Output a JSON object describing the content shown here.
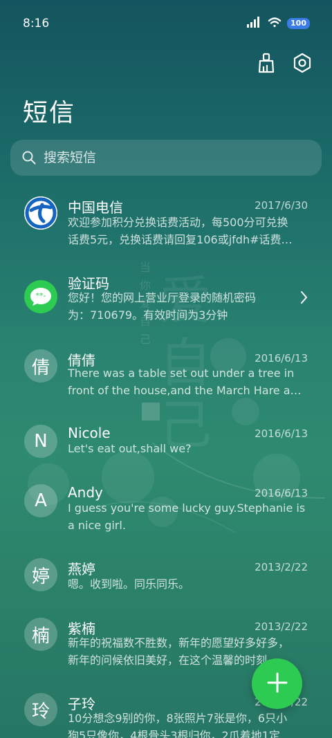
{
  "status_bar": {
    "time": "8:16",
    "battery": "100"
  },
  "header": {
    "title": "短信"
  },
  "search": {
    "placeholder": "搜索短信"
  },
  "conversations": [
    {
      "name": "中国电信",
      "date": "2017/6/30",
      "avatar_icon": "china-telecom-logo",
      "lines": [
        "欢迎参加积分兑换话费活动，每500分可兑换",
        "话费5元，兑换话费请回复106或jfdh#话费…"
      ]
    },
    {
      "name": "验证码",
      "date": "",
      "avatar_icon": "message-bubble-icon",
      "lines": [
        "您好！您的网上营业厅登录的随机密码",
        "为：710679。有效时间为3分钟"
      ]
    },
    {
      "name": "倩倩",
      "date": "2016/6/13",
      "avatar": "倩",
      "lines": [
        "There was a table set out under a tree in",
        "front of the house,and the March Hare an…"
      ]
    },
    {
      "name": "Nicole",
      "date": "2016/6/13",
      "avatar": "N",
      "lines": [
        "Let's eat out,shall we?"
      ]
    },
    {
      "name": "Andy",
      "date": "2016/6/13",
      "avatar": "A",
      "lines": [
        "I guess you're some lucky guy.Stephanie is",
        "a nice girl."
      ]
    },
    {
      "name": "燕婷",
      "date": "2013/2/22",
      "avatar": "婷",
      "lines": [
        "嗯。收到啦。同乐同乐。"
      ]
    },
    {
      "name": "紫楠",
      "date": "2013/2/22",
      "avatar": "楠",
      "lines": [
        "新年的祝福数不胜数，新年的愿望好多好多，",
        "新年的问候依旧美好，在这个温馨的时刻…"
      ]
    },
    {
      "name": "子玲",
      "date": "2013/2/22",
      "avatar": "玲",
      "lines": [
        "10分想念9别的你，8张照片7张是你，6只小",
        "狗5只像你，4根骨头3根归你，2爪着地1定…"
      ]
    }
  ],
  "wallpaper": {
    "text_column": [
      "当",
      "你",
      "爱",
      "自",
      "己"
    ],
    "big_text": "爱自己"
  },
  "colors": {
    "fab": "#2ecb52",
    "battery": "#3a7de6",
    "telecom_blue": "#1565c0"
  }
}
